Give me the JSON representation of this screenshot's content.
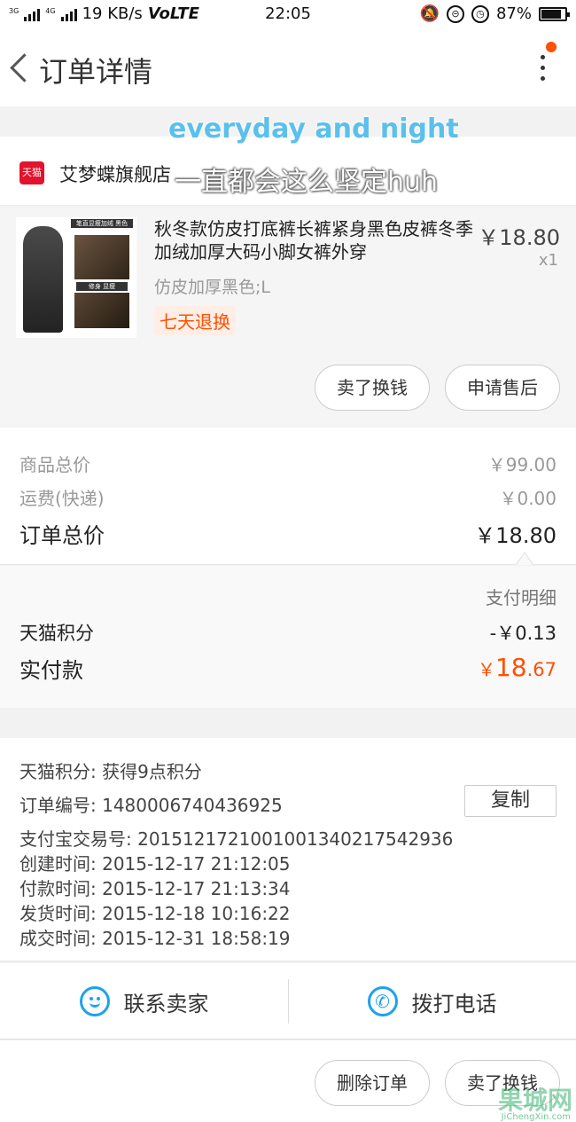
{
  "status_bar": {
    "net1": "3G",
    "net2": "4G",
    "speed": "19 KB/s",
    "volte": "VoLTE",
    "time": "22:05",
    "battery": "87%"
  },
  "nav": {
    "title": "订单详情"
  },
  "overlay": {
    "line1": "everyday and night",
    "line2": "一直都会这么坚定huh"
  },
  "store": {
    "logo_text": "天猫",
    "name": "艾梦蝶旗舰店"
  },
  "product": {
    "image_tag_top": "笔直显瘦加绒 黑色",
    "image_tag_mid": "修身  显瘦",
    "title": "秋冬款仿皮打底裤长裤紧身黑色皮裤冬季加绒加厚大码小脚女裤外穿",
    "price": "￥18.80",
    "quantity": "x1",
    "sku": "仿皮加厚黑色;L",
    "badge": "七天退换",
    "btn_sell": "卖了换钱",
    "btn_aftersale": "申请售后"
  },
  "summary": {
    "goods_total_label": "商品总价",
    "goods_total_value": "￥99.00",
    "shipping_label": "运费(快递)",
    "shipping_value": "￥0.00",
    "order_total_label": "订单总价",
    "order_total_value": "￥18.80"
  },
  "payment": {
    "detail_link": "支付明细",
    "points_label": "天猫积分",
    "points_value": "-￥0.13",
    "paid_label": "实付款",
    "paid_symbol": "￥",
    "paid_int": "18",
    "paid_dec": ".67"
  },
  "info": {
    "points": "天猫积分:   获得9点积分",
    "order_no": "订单编号:   1480006740436925",
    "copy": "复制",
    "alipay_no": "支付宝交易号:   2015121721001001340217542936",
    "created": "创建时间:   2015-12-17 21:12:05",
    "paid": "付款时间:   2015-12-17 21:13:34",
    "shipped": "发货时间:   2015-12-18 10:16:22",
    "completed": "成交时间:   2015-12-31 18:58:19"
  },
  "contact": {
    "seller": "联系卖家",
    "call": "拨打电话"
  },
  "bottom": {
    "delete": "删除订单",
    "sell": "卖了换钱"
  },
  "watermark": {
    "main": "果城网",
    "sub": "JiChengXin.com"
  },
  "colors": {
    "accent": "#ff5000",
    "tmall_red": "#e4122c",
    "icon_blue": "#1da1f2"
  }
}
